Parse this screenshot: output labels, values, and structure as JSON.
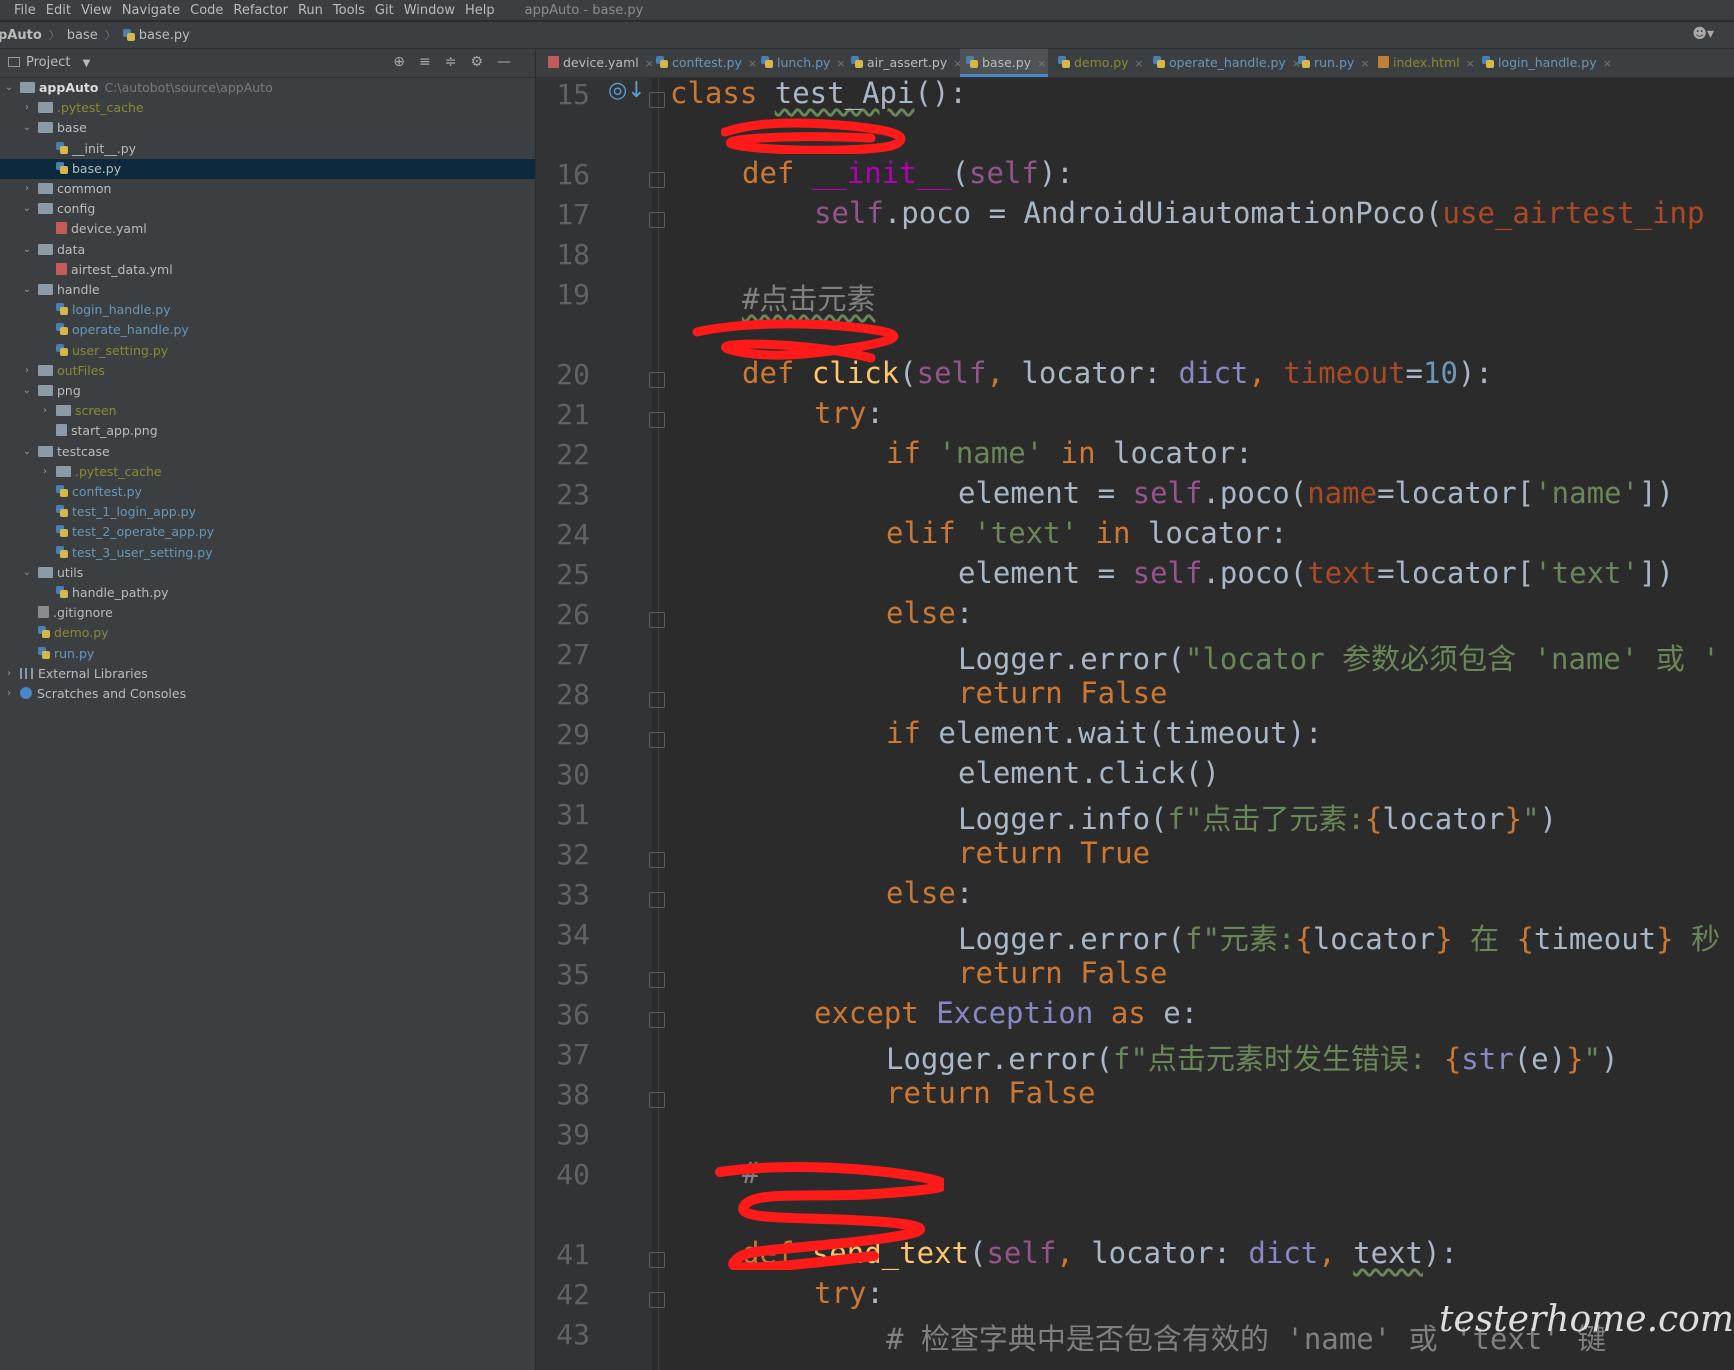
{
  "menubar": {
    "items": [
      "File",
      "Edit",
      "View",
      "Navigate",
      "Code",
      "Refactor",
      "Run",
      "Tools",
      "Git",
      "Window",
      "Help"
    ],
    "window_title": "appAuto - base.py"
  },
  "navbar": {
    "project": "pAuto",
    "folder": "base",
    "file": "base.py",
    "user_icon": "user-dropdown-icon"
  },
  "project_panel": {
    "title": "Project",
    "tools": [
      "target-icon",
      "expand-icon",
      "collapse-icon",
      "gear-icon",
      "minimize-icon"
    ],
    "tree": [
      {
        "label": "appAuto",
        "path": "C:\\autobot\\source\\appAuto",
        "kind": "folder",
        "state": "open",
        "color": "bold"
      },
      {
        "label": ".pytest_cache",
        "kind": "folder",
        "state": "closed",
        "color": "ign"
      },
      {
        "label": "base",
        "kind": "folder",
        "state": "open",
        "color": "def"
      },
      {
        "label": "__init__.py",
        "kind": "py",
        "color": "def"
      },
      {
        "label": "base.py",
        "kind": "py",
        "color": "def",
        "selected": true
      },
      {
        "label": "common",
        "kind": "folder",
        "state": "closed",
        "color": "def"
      },
      {
        "label": "config",
        "kind": "folder",
        "state": "open",
        "color": "def"
      },
      {
        "label": "device.yaml",
        "kind": "yaml",
        "color": "def"
      },
      {
        "label": "data",
        "kind": "folder",
        "state": "open",
        "color": "def"
      },
      {
        "label": "airtest_data.yml",
        "kind": "yaml",
        "color": "def"
      },
      {
        "label": "handle",
        "kind": "folder",
        "state": "open",
        "color": "def"
      },
      {
        "label": "login_handle.py",
        "kind": "py",
        "color": "blue"
      },
      {
        "label": "operate_handle.py",
        "kind": "py",
        "color": "blue"
      },
      {
        "label": "user_setting.py",
        "kind": "py",
        "color": "ign"
      },
      {
        "label": "outFiles",
        "kind": "folder",
        "state": "closed",
        "color": "ign"
      },
      {
        "label": "png",
        "kind": "folder",
        "state": "open",
        "color": "def"
      },
      {
        "label": "screen",
        "kind": "folder",
        "state": "closed",
        "color": "ign"
      },
      {
        "label": "start_app.png",
        "kind": "png",
        "color": "def"
      },
      {
        "label": "testcase",
        "kind": "folder",
        "state": "open",
        "color": "def"
      },
      {
        "label": ".pytest_cache",
        "kind": "folder",
        "state": "closed",
        "color": "ign"
      },
      {
        "label": "conftest.py",
        "kind": "py",
        "color": "blue"
      },
      {
        "label": "test_1_login_app.py",
        "kind": "py",
        "color": "blue"
      },
      {
        "label": "test_2_operate_app.py",
        "kind": "py",
        "color": "blue"
      },
      {
        "label": "test_3_user_setting.py",
        "kind": "py",
        "color": "blue"
      },
      {
        "label": "utils",
        "kind": "folder",
        "state": "open",
        "color": "def"
      },
      {
        "label": "handle_path.py",
        "kind": "py",
        "color": "def"
      },
      {
        "label": ".gitignore",
        "kind": "git",
        "color": "def"
      },
      {
        "label": "demo.py",
        "kind": "py",
        "color": "ign"
      },
      {
        "label": "run.py",
        "kind": "py",
        "color": "blue"
      },
      {
        "label": "External Libraries",
        "kind": "lib",
        "state": "closed",
        "color": "def"
      },
      {
        "label": "Scratches and Consoles",
        "kind": "scratch",
        "state": "closed",
        "color": "def"
      }
    ]
  },
  "tabs": [
    {
      "label": "device.yaml",
      "kind": "yaml",
      "color": "def"
    },
    {
      "label": "conftest.py",
      "kind": "py",
      "color": "blue"
    },
    {
      "label": "lunch.py",
      "kind": "py",
      "color": "blue"
    },
    {
      "label": "air_assert.py",
      "kind": "py",
      "color": "def"
    },
    {
      "label": "base.py",
      "kind": "py",
      "color": "def",
      "active": true
    },
    {
      "label": "demo.py",
      "kind": "py",
      "color": "ign"
    },
    {
      "label": "operate_handle.py",
      "kind": "py",
      "color": "blue"
    },
    {
      "label": "run.py",
      "kind": "py",
      "color": "blue"
    },
    {
      "label": "index.html",
      "kind": "html",
      "color": "ign"
    },
    {
      "label": "login_handle.py",
      "kind": "py",
      "color": "blue"
    }
  ],
  "editor": {
    "line_numbers": [
      "15",
      "16",
      "17",
      "18",
      "19",
      "20",
      "21",
      "22",
      "23",
      "24",
      "25",
      "26",
      "27",
      "28",
      "29",
      "30",
      "31",
      "32",
      "33",
      "34",
      "35",
      "36",
      "37",
      "38",
      "39",
      "40",
      "41",
      "42",
      "43"
    ],
    "code_text": {
      "l15": "class test_Api():",
      "l16": "def __init__(self):",
      "l17": "self.poco = AndroidUiautomationPoco(use_airtest_inp",
      "l19": "#点击元素",
      "l20": "def click(self, locator: dict, timeout=10):",
      "l21": "try:",
      "l22": "if 'name' in locator:",
      "l23": "element = self.poco(name=locator['name'])",
      "l24": "elif 'text' in locator:",
      "l25": "element = self.poco(text=locator['text'])",
      "l26": "else:",
      "l27": "Logger.error(\"locator 参数必须包含 'name' 或 '",
      "l28": "return False",
      "l29": "if element.wait(timeout):",
      "l30": "element.click()",
      "l31": "Logger.info(f\"点击了元素:{locator}\")",
      "l32": "return True",
      "l33": "else:",
      "l34": "Logger.error(f\"元素:{locator} 在 {timeout} 秒",
      "l35": "return False",
      "l36": "except Exception as e:",
      "l37": "Logger.error(f\"点击元素时发生错误: {str(e)}\")",
      "l38": "return False",
      "l40": "#",
      "l41": "def send_text(self, locator: dict, text):",
      "l42": "try:",
      "l43": "# 检查字典中是否包含有效的 'name' 或 'text' 键"
    }
  },
  "watermark": "testerhome.com",
  "colors": {
    "keyword": "#cc7832",
    "string": "#6a8759",
    "number": "#6897bb",
    "self": "#94558d",
    "function": "#ffc66d",
    "magic": "#b200b2",
    "comment": "#808080",
    "kwarg": "#aa4926",
    "builtin": "#8888c6",
    "redaction": "#ff1a1a",
    "selection": "#0d293e"
  }
}
